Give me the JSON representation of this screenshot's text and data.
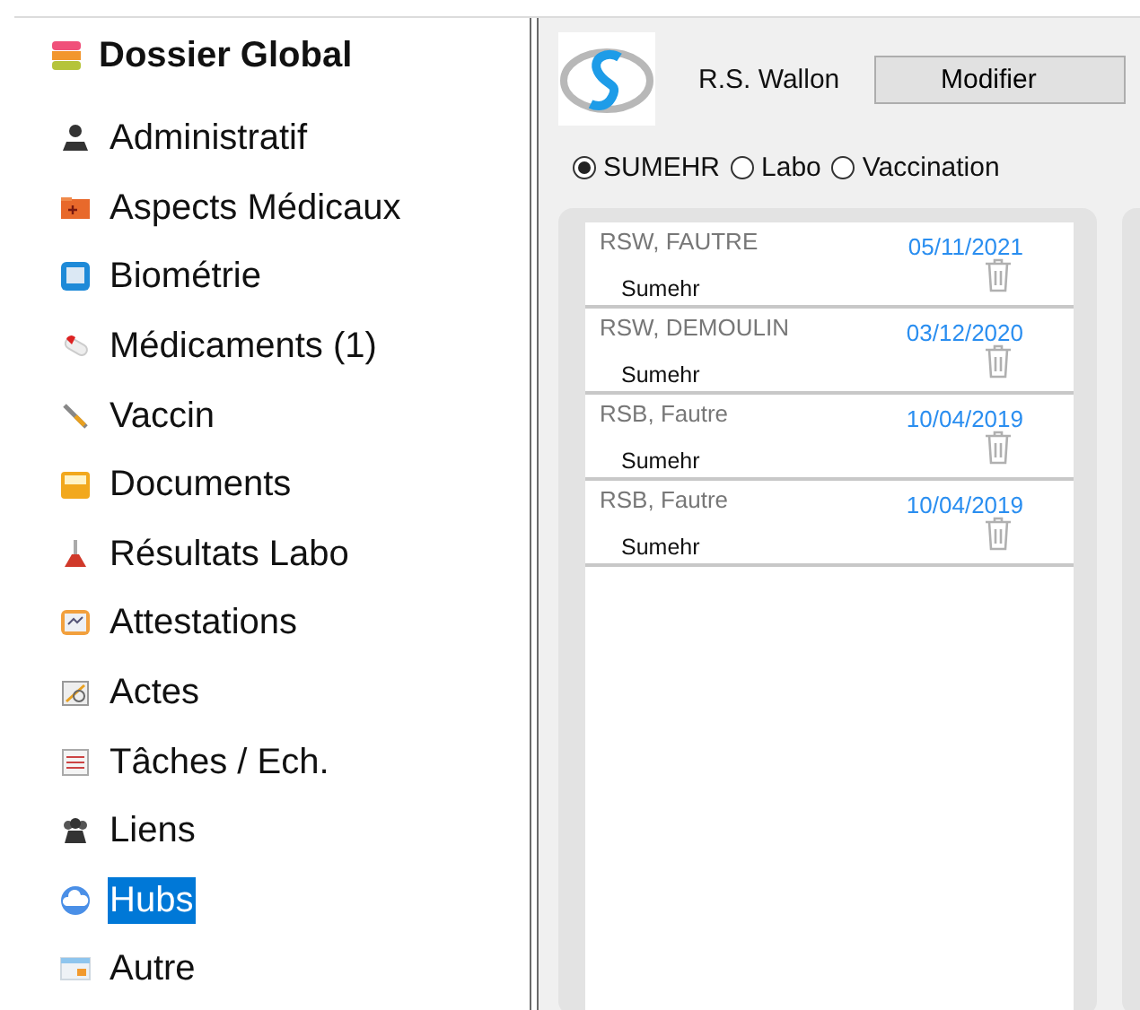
{
  "sidebar": {
    "title": "Dossier Global",
    "items": [
      {
        "label": "Administratif",
        "selected": false
      },
      {
        "label": "Aspects Médicaux",
        "selected": false
      },
      {
        "label": "Biométrie",
        "selected": false
      },
      {
        "label": "Médicaments (1)",
        "selected": false
      },
      {
        "label": "Vaccin",
        "selected": false
      },
      {
        "label": "Documents",
        "selected": false
      },
      {
        "label": "Résultats Labo",
        "selected": false
      },
      {
        "label": "Attestations",
        "selected": false
      },
      {
        "label": "Actes",
        "selected": false
      },
      {
        "label": "Tâches / Ech.",
        "selected": false
      },
      {
        "label": "Liens",
        "selected": false
      },
      {
        "label": "Hubs",
        "selected": true
      },
      {
        "label": "Autre",
        "selected": false
      }
    ]
  },
  "header": {
    "provider": "R.S. Wallon",
    "button": "Modifier"
  },
  "filters": [
    {
      "label": "SUMEHR",
      "selected": true
    },
    {
      "label": "Labo",
      "selected": false
    },
    {
      "label": "Vaccination",
      "selected": false
    }
  ],
  "documents": [
    {
      "author": "RSW, FAUTRE",
      "date": "05/11/2021",
      "type": "Sumehr"
    },
    {
      "author": "RSW, DEMOULIN",
      "date": "03/12/2020",
      "type": "Sumehr"
    },
    {
      "author": "RSB, Fautre",
      "date": "10/04/2019",
      "type": "Sumehr"
    },
    {
      "author": "RSB, Fautre",
      "date": "10/04/2019",
      "type": "Sumehr"
    }
  ]
}
